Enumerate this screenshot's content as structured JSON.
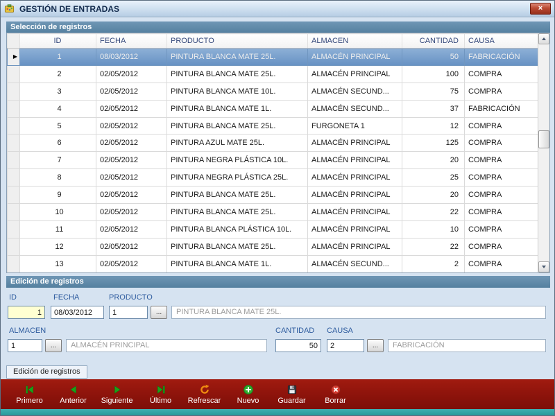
{
  "window": {
    "title": "GESTIÓN DE ENTRADAS",
    "close_glyph": "×"
  },
  "selection": {
    "title": "Selección de registros",
    "grid": {
      "selected_index": 0,
      "selector_glyph": "▶",
      "columns": [
        "ID",
        "FECHA",
        "PRODUCTO",
        "ALMACEN",
        "CANTIDAD",
        "CAUSA"
      ],
      "rows": [
        {
          "id": "1",
          "fecha": "08/03/2012",
          "producto": "PINTURA BLANCA MATE 25L.",
          "almacen": "ALMACÉN PRINCIPAL",
          "cantidad": "50",
          "causa": "FABRICACIÓN"
        },
        {
          "id": "2",
          "fecha": "02/05/2012",
          "producto": "PINTURA BLANCA MATE 25L.",
          "almacen": "ALMACÉN PRINCIPAL",
          "cantidad": "100",
          "causa": "COMPRA"
        },
        {
          "id": "3",
          "fecha": "02/05/2012",
          "producto": "PINTURA BLANCA MATE 10L.",
          "almacen": "ALMACÉN SECUND...",
          "cantidad": "75",
          "causa": "COMPRA"
        },
        {
          "id": "4",
          "fecha": "02/05/2012",
          "producto": "PINTURA BLANCA MATE 1L.",
          "almacen": "ALMACÉN SECUND...",
          "cantidad": "37",
          "causa": "FABRICACIÓN"
        },
        {
          "id": "5",
          "fecha": "02/05/2012",
          "producto": "PINTURA BLANCA MATE 25L.",
          "almacen": "FURGONETA 1",
          "cantidad": "12",
          "causa": "COMPRA"
        },
        {
          "id": "6",
          "fecha": "02/05/2012",
          "producto": "PINTURA AZUL MATE 25L.",
          "almacen": "ALMACÉN PRINCIPAL",
          "cantidad": "125",
          "causa": "COMPRA"
        },
        {
          "id": "7",
          "fecha": "02/05/2012",
          "producto": "PINTURA NEGRA PLÁSTICA 10L.",
          "almacen": "ALMACÉN PRINCIPAL",
          "cantidad": "20",
          "causa": "COMPRA"
        },
        {
          "id": "8",
          "fecha": "02/05/2012",
          "producto": "PINTURA NEGRA PLÁSTICA 25L.",
          "almacen": "ALMACÉN PRINCIPAL",
          "cantidad": "25",
          "causa": "COMPRA"
        },
        {
          "id": "9",
          "fecha": "02/05/2012",
          "producto": "PINTURA BLANCA MATE 25L.",
          "almacen": "ALMACÉN PRINCIPAL",
          "cantidad": "20",
          "causa": "COMPRA"
        },
        {
          "id": "10",
          "fecha": "02/05/2012",
          "producto": "PINTURA BLANCA MATE 25L.",
          "almacen": "ALMACÉN PRINCIPAL",
          "cantidad": "22",
          "causa": "COMPRA"
        },
        {
          "id": "11",
          "fecha": "02/05/2012",
          "producto": "PINTURA BLANCA PLÁSTICA 10L.",
          "almacen": "ALMACÉN PRINCIPAL",
          "cantidad": "10",
          "causa": "COMPRA"
        },
        {
          "id": "12",
          "fecha": "02/05/2012",
          "producto": "PINTURA BLANCA MATE 25L.",
          "almacen": "ALMACÉN PRINCIPAL",
          "cantidad": "22",
          "causa": "COMPRA"
        },
        {
          "id": "13",
          "fecha": "02/05/2012",
          "producto": "PINTURA BLANCA MATE 1L.",
          "almacen": "ALMACÉN SECUND...",
          "cantidad": "2",
          "causa": "COMPRA"
        }
      ]
    }
  },
  "edition": {
    "title": "Edición de registros",
    "tab_label": "Edición de registros",
    "ellipsis": "...",
    "labels": {
      "id": "ID",
      "fecha": "FECHA",
      "producto": "PRODUCTO",
      "almacen": "ALMACEN",
      "cantidad": "CANTIDAD",
      "causa": "CAUSA"
    },
    "values": {
      "id": "1",
      "fecha": "08/03/2012",
      "producto_code": "1",
      "producto_name": "PINTURA BLANCA MATE 25L.",
      "almacen_code": "1",
      "almacen_name": "ALMACÉN PRINCIPAL",
      "cantidad": "50",
      "causa_code": "2",
      "causa_name": "FABRICACIÓN"
    }
  },
  "toolbar": {
    "buttons": [
      {
        "label": "Primero"
      },
      {
        "label": "Anterior"
      },
      {
        "label": "Siguiente"
      },
      {
        "label": "Último"
      },
      {
        "label": "Refrescar"
      },
      {
        "label": "Nuevo"
      },
      {
        "label": "Guardar"
      },
      {
        "label": "Borrar"
      }
    ]
  },
  "colors": {
    "section_header": "#54809f",
    "toolbar_bg": "#8c130b",
    "footer_bar": "#2aa0a0",
    "selected_row": "#6691c3",
    "id_cell_bg": "#ffffd2",
    "label_blue": "#2d5b9e"
  }
}
